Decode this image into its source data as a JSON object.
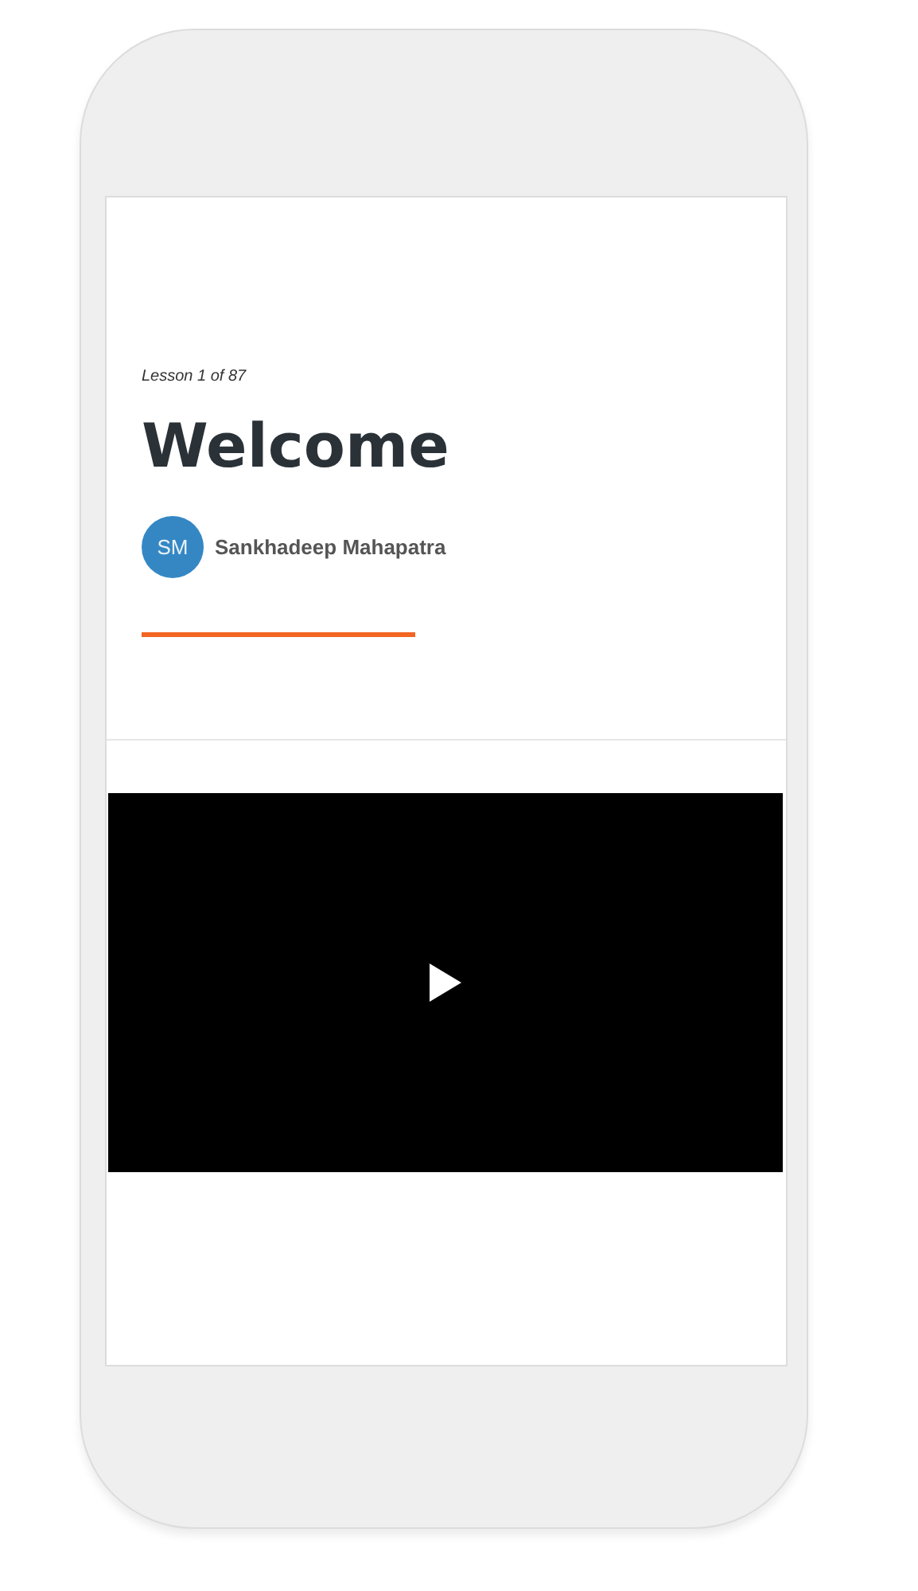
{
  "lesson": {
    "progress": "Lesson 1 of 87",
    "title": "Welcome"
  },
  "author": {
    "initials": "SM",
    "name": "Sankhadeep Mahapatra"
  },
  "video": {
    "kind": "player"
  }
}
